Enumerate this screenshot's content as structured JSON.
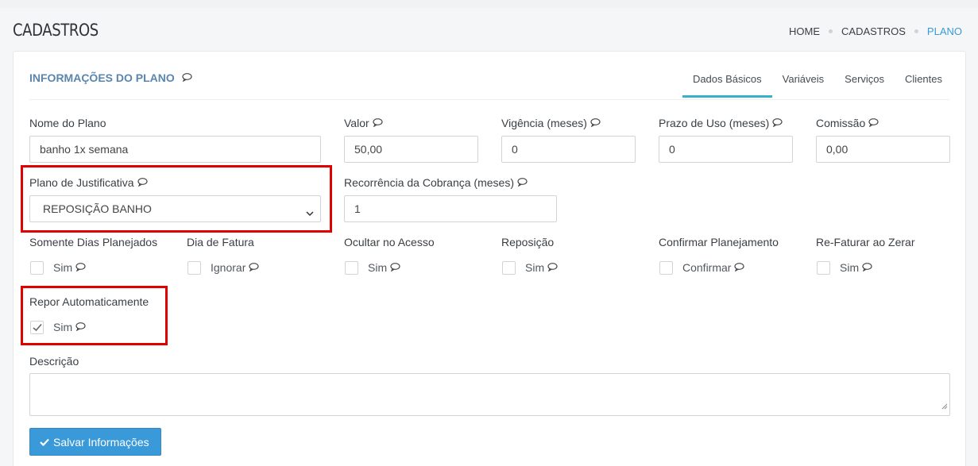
{
  "page": {
    "title": "CADASTROS",
    "breadcrumb": [
      "HOME",
      "CADASTROS",
      "PLANO"
    ]
  },
  "card": {
    "title": "INFORMAÇÕES DO PLANO",
    "tabs": [
      "Dados Básicos",
      "Variáveis",
      "Serviços",
      "Clientes"
    ],
    "active_tab": "Dados Básicos"
  },
  "fields": {
    "nome_plano": {
      "label": "Nome do Plano",
      "value": "banho 1x semana"
    },
    "valor": {
      "label": "Valor",
      "value": "50,00"
    },
    "vigencia": {
      "label": "Vigência (meses)",
      "value": "0"
    },
    "prazo_uso": {
      "label": "Prazo de Uso (meses)",
      "value": "0"
    },
    "comissao": {
      "label": "Comissão",
      "value": "0,00"
    },
    "plano_justificativa": {
      "label": "Plano de Justificativa",
      "value": "REPOSIÇÃO BANHO"
    },
    "recorrencia": {
      "label": "Recorrência da Cobrança (meses)",
      "value": "1"
    }
  },
  "checkboxes": [
    {
      "label": "Somente Dias Planejados",
      "option": "Sim",
      "checked": false
    },
    {
      "label": "Dia de Fatura",
      "option": "Ignorar",
      "checked": false
    },
    {
      "label": "Ocultar no Acesso",
      "option": "Sim",
      "checked": false
    },
    {
      "label": "Reposição",
      "option": "Sim",
      "checked": false
    },
    {
      "label": "Confirmar Planejamento",
      "option": "Confirmar",
      "checked": false
    },
    {
      "label": "Re-Faturar ao Zerar",
      "option": "Sim",
      "checked": false
    },
    {
      "label": "Repor Automaticamente",
      "option": "Sim",
      "checked": true
    }
  ],
  "descricao": {
    "label": "Descrição",
    "value": ""
  },
  "actions": {
    "save_label": "Salvar Informações"
  },
  "colors": {
    "accent": "#3a9ad9",
    "tab_underline": "#36b2c9",
    "highlight": "#e00000",
    "title": "#5a86ae"
  },
  "icons": [
    "comment-icon",
    "chevron-down-icon",
    "check-icon",
    "resize-handle-icon"
  ]
}
